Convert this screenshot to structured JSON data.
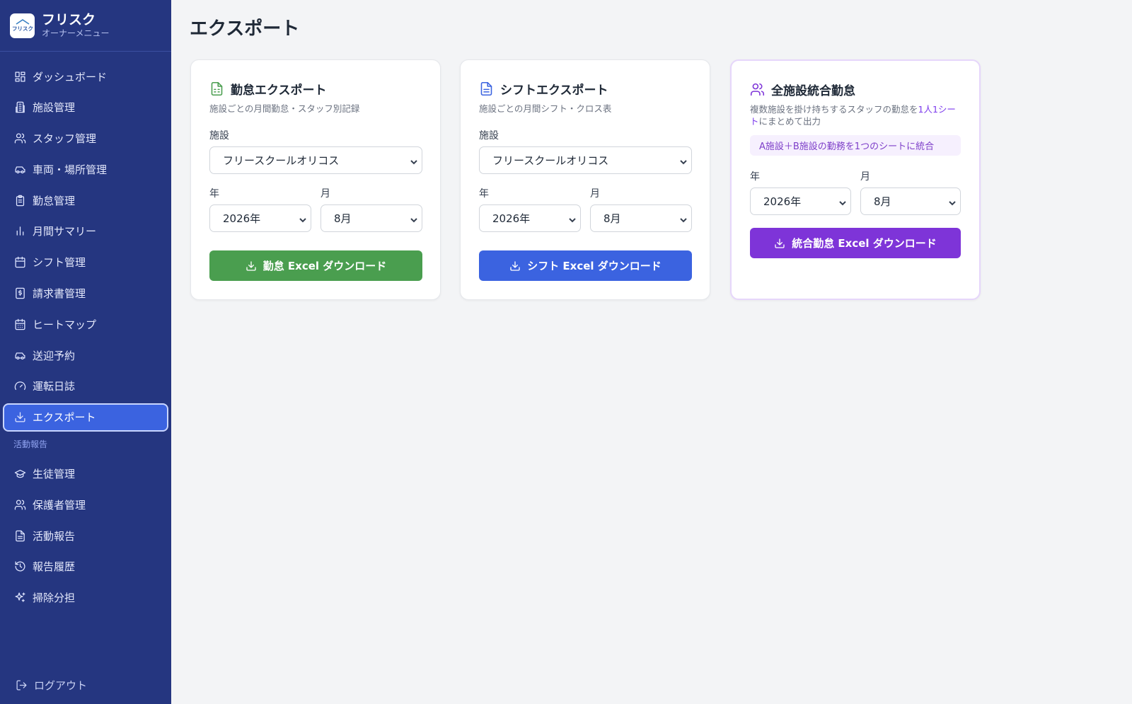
{
  "brand": {
    "name": "フリスク",
    "subtitle": "オーナーメニュー",
    "logo_text": "フリスク"
  },
  "sidebar": {
    "items": [
      {
        "label": "ダッシュボード",
        "icon": "dashboard-icon"
      },
      {
        "label": "施設管理",
        "icon": "building-icon"
      },
      {
        "label": "スタッフ管理",
        "icon": "users-icon"
      },
      {
        "label": "車両・場所管理",
        "icon": "car-icon"
      },
      {
        "label": "勤怠管理",
        "icon": "clipboard-icon"
      },
      {
        "label": "月間サマリー",
        "icon": "bar-chart-icon"
      },
      {
        "label": "シフト管理",
        "icon": "calendar-icon"
      },
      {
        "label": "請求書管理",
        "icon": "invoice-icon"
      },
      {
        "label": "ヒートマップ",
        "icon": "calendar-grid-icon"
      },
      {
        "label": "送迎予約",
        "icon": "car-icon"
      },
      {
        "label": "運転日誌",
        "icon": "gauge-icon"
      },
      {
        "label": "エクスポート",
        "icon": "download-icon",
        "active": true
      }
    ],
    "section_label": "活動報告",
    "section_items": [
      {
        "label": "生徒管理",
        "icon": "graduation-cap-icon"
      },
      {
        "label": "保護者管理",
        "icon": "users-icon"
      },
      {
        "label": "活動報告",
        "icon": "document-icon"
      },
      {
        "label": "報告履歴",
        "icon": "history-icon"
      },
      {
        "label": "掃除分担",
        "icon": "sparkles-icon"
      }
    ],
    "logout_label": "ログアウト"
  },
  "page": {
    "title": "エクスポート"
  },
  "cards": [
    {
      "title": "勤怠エクスポート",
      "description": "施設ごとの月間勤怠・スタッフ別記録",
      "facility_label": "施設",
      "facility_value": "フリースクールオリコス",
      "year_label": "年",
      "year_value": "2026年",
      "month_label": "月",
      "month_value": "8月",
      "button_label": "勤怠 Excel ダウンロード",
      "accent": "#4a9e4f",
      "icon": "spreadsheet-icon"
    },
    {
      "title": "シフトエクスポート",
      "description": "施設ごとの月間シフト・クロス表",
      "facility_label": "施設",
      "facility_value": "フリースクールオリコス",
      "year_label": "年",
      "year_value": "2026年",
      "month_label": "月",
      "month_value": "8月",
      "button_label": "シフト Excel ダウンロード",
      "accent": "#3b63e0",
      "icon": "document-icon"
    },
    {
      "title": "全施設統合勤怠",
      "description_part1": "複数施設を掛け持ちするスタッフの勤怠を",
      "description_highlight": "1人1シート",
      "description_part2": "にまとめて出力",
      "note": "A施設＋B施設の勤務を1つのシートに統合",
      "year_label": "年",
      "year_value": "2026年",
      "month_label": "月",
      "month_value": "8月",
      "button_label": "統合勤怠 Excel ダウンロード",
      "accent": "#7e34d8",
      "icon": "users-icon"
    }
  ],
  "colors": {
    "sidebar_bg": "#253680",
    "active_bg": "#3b63e0",
    "page_bg": "#f3f4f6"
  }
}
